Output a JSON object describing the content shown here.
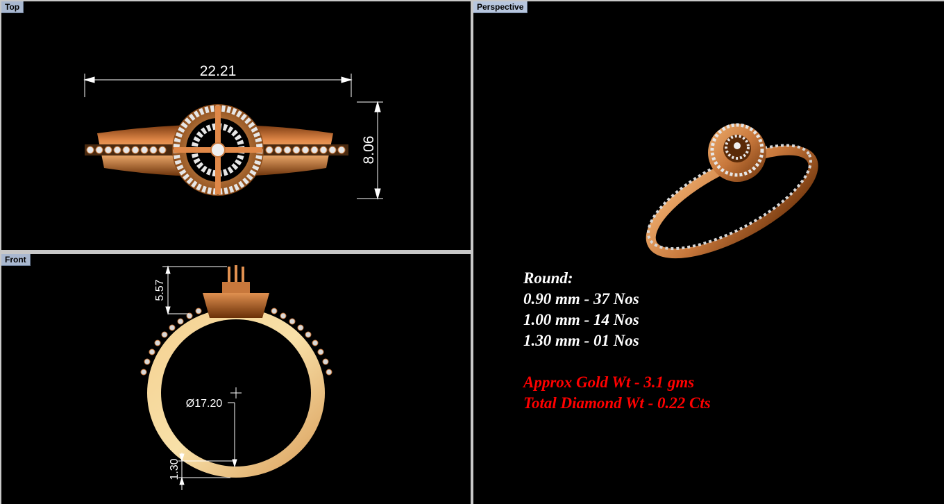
{
  "viewports": {
    "top": {
      "label": "Top",
      "dim_width": "22.21",
      "dim_height": "8.06"
    },
    "front": {
      "label": "Front",
      "dim_height": "5.57",
      "dim_diameter": "Ø17.20",
      "dim_thickness": "1.30"
    },
    "perspective": {
      "label": "Perspective"
    }
  },
  "specs": {
    "heading": "Round:",
    "lines": [
      "0.90 mm - 37 Nos",
      "1.00 mm - 14 Nos",
      "1.30 mm - 01 Nos"
    ],
    "gold_weight": "Approx Gold Wt - 3.1 gms",
    "diamond_weight": "Total Diamond Wt - 0.22 Cts"
  },
  "colors": {
    "background": "#000000",
    "gold": "#c8783c",
    "gold_light": "#f0c890",
    "diamond": "#e6e6e6",
    "highlight_text": "#ff0000",
    "label_bg": "#a9b8d0"
  }
}
